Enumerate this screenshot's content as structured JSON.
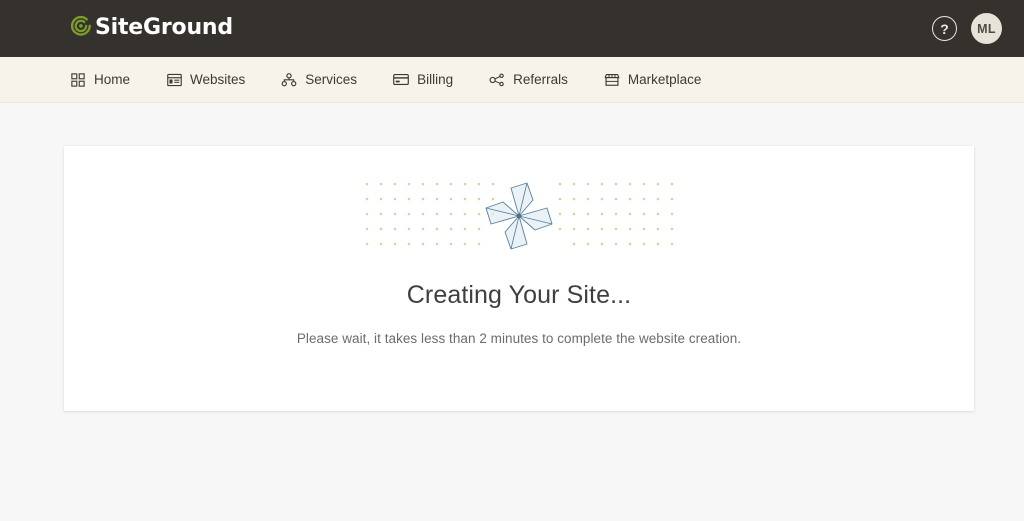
{
  "header": {
    "brand_name": "SiteGround",
    "brand_mark_icon": "siteground-spiral-logo-icon",
    "brand_mark_color": "#7d9d2a",
    "background_color": "#35312d",
    "help_label": "?",
    "help_icon": "question-mark-circle-icon",
    "avatar_initials": "ML",
    "avatar_color": "#e7e3d8"
  },
  "nav": {
    "background_color": "#f6f4ea",
    "items": [
      {
        "label": "Home",
        "icon": "grid-squares-icon"
      },
      {
        "label": "Websites",
        "icon": "browser-window-icon"
      },
      {
        "label": "Services",
        "icon": "hierarchy-nodes-icon"
      },
      {
        "label": "Billing",
        "icon": "credit-card-icon"
      },
      {
        "label": "Referrals",
        "icon": "share-network-icon"
      },
      {
        "label": "Marketplace",
        "icon": "storefront-awning-icon"
      }
    ]
  },
  "main": {
    "card": {
      "illustration": {
        "name": "pinwheel-loading-illustration",
        "pinwheel_stroke_color": "#5a7f99",
        "pinwheel_fill_color": "#dfeaf2",
        "dot_color": "#d8d2a8",
        "dot_rows": 5,
        "dot_cols_per_side": 11
      },
      "title": "Creating Your Site...",
      "subtitle": "Please wait, it takes less than 2 minutes to complete the website creation.",
      "background_color": "#ffffff"
    }
  },
  "page": {
    "background_color": "#f7f7f7"
  }
}
